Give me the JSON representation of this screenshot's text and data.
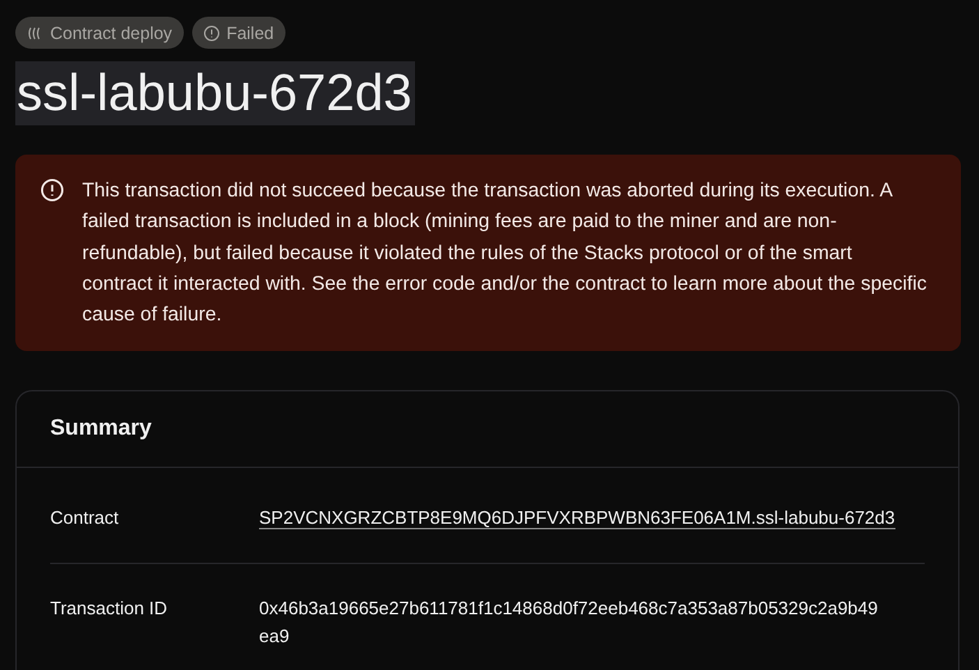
{
  "badges": [
    {
      "kind": "type",
      "label": "Contract deploy"
    },
    {
      "kind": "status",
      "label": "Failed"
    }
  ],
  "title": "ssl-labubu-672d3",
  "alert": {
    "message": "This transaction did not succeed because the transaction was aborted during its execution. A failed transaction is included in a block (mining fees are paid to the miner and are non-refundable), but failed because it violated the rules of the Stacks protocol or of the smart contract it interacted with. See the error code and/or the contract to learn more about the specific cause of failure."
  },
  "summary": {
    "title": "Summary",
    "rows": [
      {
        "label": "Contract",
        "value": "SP2VCNXGRZCBTP8E9MQ6DJPFVXRBPWBN63FE06A1M.ssl-labubu-672d3",
        "kind": "link"
      },
      {
        "label": "Transaction ID",
        "value": "0x46b3a19665e27b611781f1c14868d0f72eeb468c7a353a87b05329c2a9b49ea9",
        "kind": "text"
      }
    ]
  }
}
